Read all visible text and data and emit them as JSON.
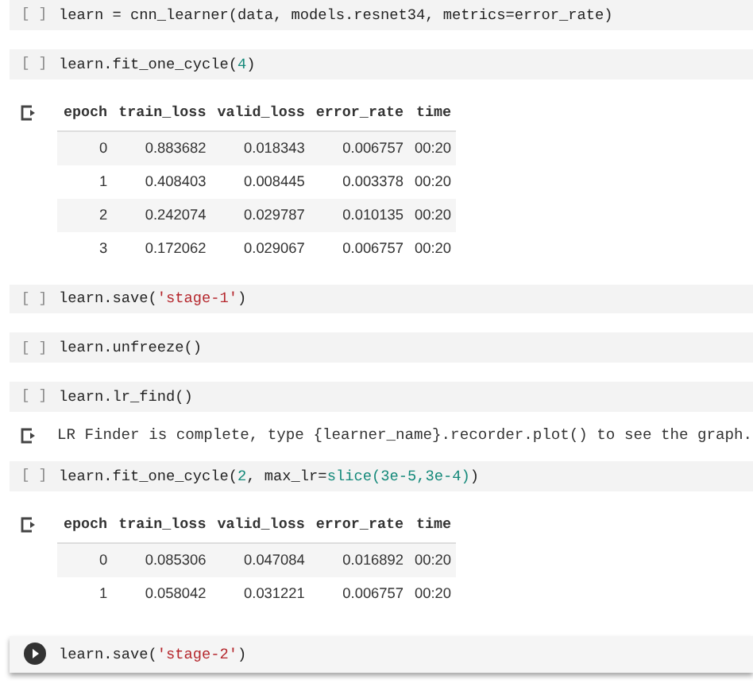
{
  "cells": [
    {
      "kind": "code",
      "selected": false,
      "marker": "[ ]",
      "code": [
        {
          "kind": "plain",
          "text": "learn = cnn_learner(data, models.resnet34, metrics=error_rate)"
        }
      ]
    },
    {
      "kind": "code",
      "selected": false,
      "marker": "[ ]",
      "code": [
        {
          "kind": "plain",
          "text": "learn.fit_one_cycle("
        },
        {
          "kind": "number",
          "text": "4"
        },
        {
          "kind": "plain",
          "text": ")"
        }
      ]
    },
    {
      "kind": "table",
      "columns": [
        "epoch",
        "train_loss",
        "valid_loss",
        "error_rate",
        "time"
      ],
      "rows": [
        [
          "0",
          "0.883682",
          "0.018343",
          "0.006757",
          "00:20"
        ],
        [
          "1",
          "0.408403",
          "0.008445",
          "0.003378",
          "00:20"
        ],
        [
          "2",
          "0.242074",
          "0.029787",
          "0.010135",
          "00:20"
        ],
        [
          "3",
          "0.172062",
          "0.029067",
          "0.006757",
          "00:20"
        ]
      ]
    },
    {
      "kind": "code",
      "selected": false,
      "marker": "[ ]",
      "code": [
        {
          "kind": "plain",
          "text": "learn.save("
        },
        {
          "kind": "string",
          "text": "'stage-1'"
        },
        {
          "kind": "plain",
          "text": ")"
        }
      ]
    },
    {
      "kind": "code",
      "selected": false,
      "marker": "[ ]",
      "code": [
        {
          "kind": "plain",
          "text": "learn.unfreeze()"
        }
      ]
    },
    {
      "kind": "code",
      "selected": false,
      "marker": "[ ]",
      "code": [
        {
          "kind": "plain",
          "text": "learn.lr_find()"
        }
      ]
    },
    {
      "kind": "text",
      "text": "LR Finder is complete, type {learner_name}.recorder.plot() to see the graph."
    },
    {
      "kind": "code",
      "selected": false,
      "marker": "[ ]",
      "code": [
        {
          "kind": "plain",
          "text": "learn.fit_one_cycle("
        },
        {
          "kind": "number",
          "text": "2"
        },
        {
          "kind": "plain",
          "text": ", max_lr="
        },
        {
          "kind": "number",
          "text": "slice(3e-5,3e-4)"
        },
        {
          "kind": "plain",
          "text": ")"
        }
      ]
    },
    {
      "kind": "table",
      "columns": [
        "epoch",
        "train_loss",
        "valid_loss",
        "error_rate",
        "time"
      ],
      "rows": [
        [
          "0",
          "0.085306",
          "0.047084",
          "0.016892",
          "00:20"
        ],
        [
          "1",
          "0.058042",
          "0.031221",
          "0.006757",
          "00:20"
        ]
      ]
    },
    {
      "kind": "code",
      "selected": true,
      "code": [
        {
          "kind": "plain",
          "text": "learn.save("
        },
        {
          "kind": "string",
          "text": "'stage-2'"
        },
        {
          "kind": "plain",
          "text": ")"
        }
      ]
    }
  ]
}
